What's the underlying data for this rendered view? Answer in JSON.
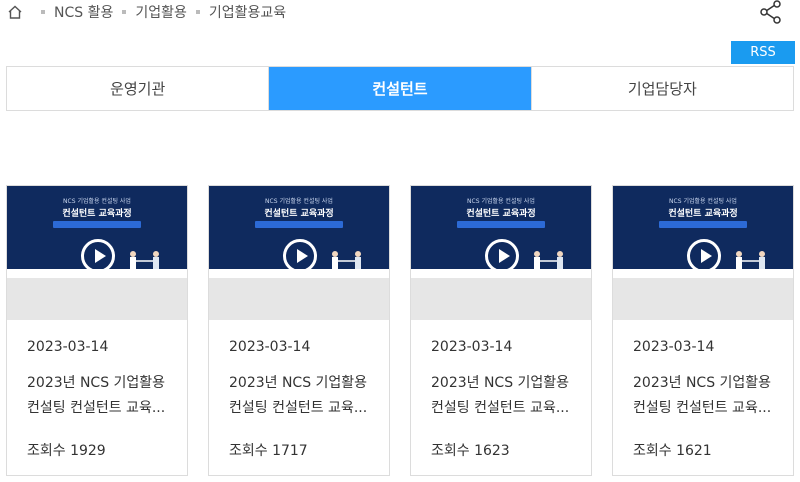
{
  "breadcrumb": {
    "home_icon": "home-icon",
    "items": [
      "NCS 활용",
      "기업활용",
      "기업활용교육"
    ]
  },
  "share_icon": "share-icon",
  "rss_label": "RSS",
  "tabs": [
    {
      "label": "운영기관",
      "active": false
    },
    {
      "label": "컨설턴트",
      "active": true
    },
    {
      "label": "기업담당자",
      "active": false
    }
  ],
  "thumbnail": {
    "line1": "NCS 기업활용 컨설팅 사업",
    "line2": "컨설턴트 교육과정",
    "play_icon": "play-icon"
  },
  "cards": [
    {
      "date": "2023-03-14",
      "title_line1": "2023년 NCS 기업활용",
      "title_line2": "컨설팅 컨설턴트 교육...",
      "views": "조회수 1929"
    },
    {
      "date": "2023-03-14",
      "title_line1": "2023년 NCS 기업활용",
      "title_line2": "컨설팅 컨설턴트 교육...",
      "views": "조회수 1717"
    },
    {
      "date": "2023-03-14",
      "title_line1": "2023년 NCS 기업활용",
      "title_line2": "컨설팅 컨설턴트 교육...",
      "views": "조회수 1623"
    },
    {
      "date": "2023-03-14",
      "title_line1": "2023년 NCS 기업활용",
      "title_line2": "컨설팅 컨설턴트 교육...",
      "views": "조회수 1621"
    }
  ],
  "colors": {
    "active_tab": "#2b9bff",
    "rss": "#1a9bf0",
    "thumb_bg": "#0f2a5e"
  }
}
